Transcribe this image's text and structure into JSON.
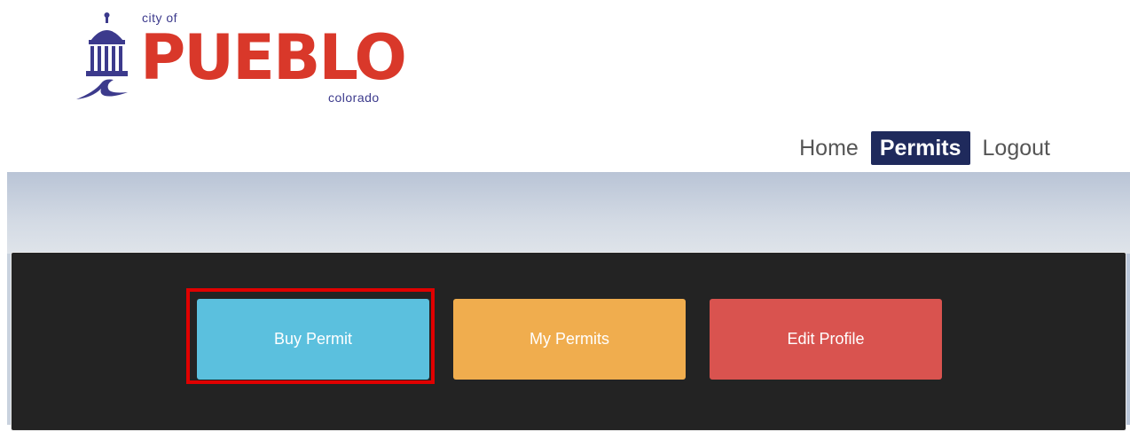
{
  "logo": {
    "city_text": "city of",
    "name": "PUEBLO",
    "state_text": "colorado"
  },
  "nav": {
    "items": [
      {
        "label": "Home",
        "active": false
      },
      {
        "label": "Permits",
        "active": true
      },
      {
        "label": "Logout",
        "active": false
      }
    ]
  },
  "actions": {
    "buy_permit": "Buy Permit",
    "my_permits": "My Permits",
    "edit_profile": "Edit Profile"
  },
  "colors": {
    "nav_active_bg": "#1f2a5c",
    "logo_red": "#d9382a",
    "logo_purple": "#3c3a8c",
    "buy_button": "#5bc0de",
    "my_permits_button": "#f0ad4e",
    "edit_profile_button": "#d9534f",
    "highlight_border": "#e00000"
  },
  "icons": {
    "logo_mark": "capitol-dome-river-icon"
  }
}
